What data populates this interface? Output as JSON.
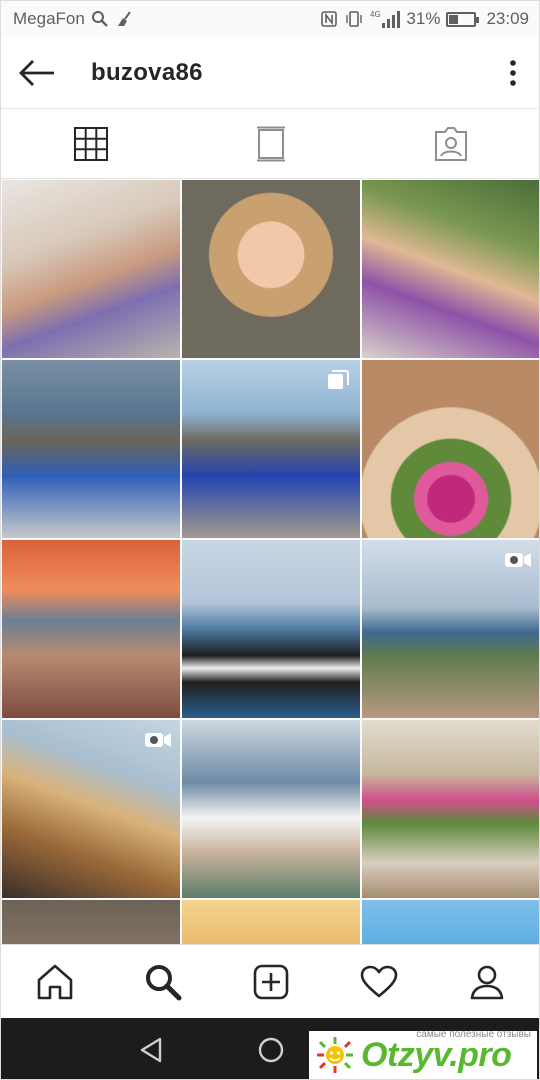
{
  "status_bar": {
    "carrier": "MegaFon",
    "network": "4G",
    "battery_percent": "31%",
    "battery_level": 0.31,
    "time": "23:09"
  },
  "header": {
    "username": "buzova86",
    "back_icon": "arrow-left-icon",
    "menu_icon": "more-vertical-icon"
  },
  "tabs": [
    {
      "name": "grid",
      "icon": "grid-icon",
      "active": true
    },
    {
      "name": "feed",
      "icon": "feed-icon",
      "active": false
    },
    {
      "name": "tagged",
      "icon": "tagged-user-icon",
      "active": false
    }
  ],
  "grid": {
    "posts": [
      {
        "kind": "photo",
        "badge": ""
      },
      {
        "kind": "photo",
        "badge": ""
      },
      {
        "kind": "photo",
        "badge": ""
      },
      {
        "kind": "photo",
        "badge": ""
      },
      {
        "kind": "carousel",
        "badge": "carousel-icon"
      },
      {
        "kind": "photo",
        "badge": ""
      },
      {
        "kind": "photo",
        "badge": ""
      },
      {
        "kind": "photo",
        "badge": ""
      },
      {
        "kind": "video",
        "badge": "video-icon"
      },
      {
        "kind": "video",
        "badge": "video-icon"
      },
      {
        "kind": "photo",
        "badge": ""
      },
      {
        "kind": "photo",
        "badge": ""
      },
      {
        "kind": "photo",
        "badge": ""
      },
      {
        "kind": "photo",
        "badge": ""
      },
      {
        "kind": "photo",
        "badge": ""
      }
    ]
  },
  "bottom_nav": [
    {
      "name": "home",
      "icon": "home-icon"
    },
    {
      "name": "search",
      "icon": "search-icon",
      "active": true
    },
    {
      "name": "new-post",
      "icon": "add-post-icon"
    },
    {
      "name": "activity",
      "icon": "heart-icon"
    },
    {
      "name": "profile",
      "icon": "profile-icon"
    }
  ],
  "android_nav": [
    "back-triangle-icon",
    "home-circle-icon"
  ],
  "watermark": {
    "tagline": "самые полезные отзывы",
    "brand": "Otzyv.pro"
  },
  "colors": {
    "accent": "#262626",
    "background": "#fafafa",
    "watermark_green": "#58b830"
  }
}
